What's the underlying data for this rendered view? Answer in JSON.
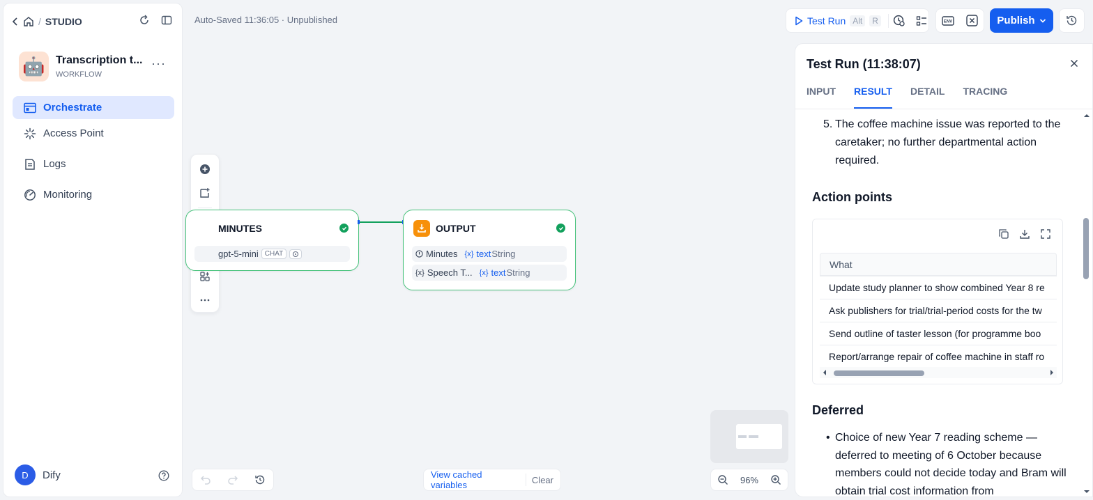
{
  "sidebar": {
    "breadcrumb": "STUDIO",
    "app": {
      "emoji": "🤖",
      "name": "Transcription t...",
      "kind": "WORKFLOW"
    },
    "nav": [
      {
        "label": "Orchestrate",
        "active": true
      },
      {
        "label": "Access Point",
        "active": false
      },
      {
        "label": "Logs",
        "active": false
      },
      {
        "label": "Monitoring",
        "active": false
      }
    ],
    "user": {
      "initial": "D",
      "name": "Dify"
    }
  },
  "canvas": {
    "autosave": "Auto-Saved 11:36:05 · Unpublished",
    "minutes_node": {
      "title": "MINUTES",
      "model": "gpt-5-mini",
      "chip": "CHAT"
    },
    "output_node": {
      "title": "OUTPUT",
      "rows": [
        {
          "name": "Minutes",
          "var": "text",
          "type": "String"
        },
        {
          "name": "Speech T...",
          "var": "text",
          "type": "String"
        }
      ]
    },
    "view_cached": "View cached variables",
    "clear": "Clear",
    "zoom": "96%"
  },
  "topbar": {
    "test_run": "Test Run",
    "kbd_alt": "Alt",
    "kbd_r": "R",
    "publish": "Publish"
  },
  "panel": {
    "title": "Test Run (11:38:07)",
    "tabs": [
      "INPUT",
      "RESULT",
      "DETAIL",
      "TRACING"
    ],
    "active_tab": "RESULT",
    "item5_num": "5.",
    "item5_text": "The coffee machine issue was reported to the caretaker; no further departmental action required.",
    "action_points_heading": "Action points",
    "table_header": "What",
    "table_rows": [
      "Update study planner to show combined Year 8 re",
      "Ask publishers for trial/trial-period costs for the tw",
      "Send outline of taster lesson (for programme boo",
      "Report/arrange repair of coffee machine in staff ro"
    ],
    "deferred_heading": "Deferred",
    "deferred_item": "Choice of new Year 7 reading scheme — deferred to meeting of 6 October because members could not decide today and Bram will obtain trial cost information from"
  }
}
